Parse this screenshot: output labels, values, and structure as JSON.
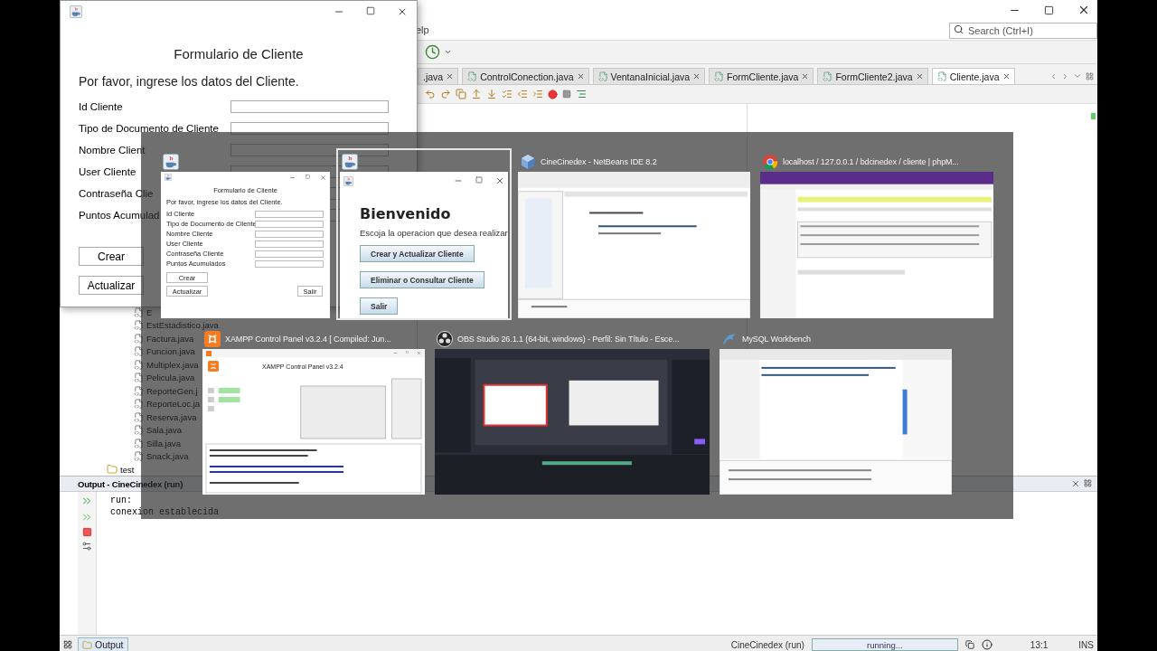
{
  "ide": {
    "menu_fragment": "elp",
    "search": {
      "placeholder": "Search (Ctrl+I)"
    },
    "editor_tabs": [
      {
        "label": ".java",
        "selected": false
      },
      {
        "label": "ControlConection.java",
        "selected": false
      },
      {
        "label": "VentanaInicial.java",
        "selected": false
      },
      {
        "label": "FormCliente.java",
        "selected": false
      },
      {
        "label": "FormCliente2.java",
        "selected": false
      },
      {
        "label": "Cliente.java",
        "selected": true
      }
    ],
    "project_tree": [
      {
        "label": "E",
        "kind": "file"
      },
      {
        "label": "EstEstadistico.java",
        "kind": "file"
      },
      {
        "label": "Factura.java",
        "kind": "file"
      },
      {
        "label": "Funcion.java",
        "kind": "file"
      },
      {
        "label": "Multiplex.java",
        "kind": "file"
      },
      {
        "label": "Pelicula.java",
        "kind": "file"
      },
      {
        "label": "ReporteGen.j",
        "kind": "file"
      },
      {
        "label": "ReporteLoc.ja",
        "kind": "file"
      },
      {
        "label": "Reserva.java",
        "kind": "file"
      },
      {
        "label": "Sala.java",
        "kind": "file"
      },
      {
        "label": "Silla.java",
        "kind": "file"
      },
      {
        "label": "Snack.java",
        "kind": "file"
      },
      {
        "label": "test",
        "kind": "folder"
      }
    ],
    "output": {
      "title": "Output - CineCinedex (run)",
      "lines": [
        "run:",
        "conexion establecida"
      ]
    },
    "status_bar": {
      "panel_tab": "Output",
      "task": "CineCinedex (run)",
      "progress": "running...",
      "position": "13:1",
      "mode": "INS"
    }
  },
  "form_window": {
    "heading": "Formulario de Cliente",
    "intro": "Por favor, ingrese los datos del Cliente.",
    "fields": [
      {
        "label": "Id Cliente"
      },
      {
        "label": "Tipo de Documento de Cliente"
      },
      {
        "label": "Nombre Client"
      },
      {
        "label": "User Cliente"
      },
      {
        "label": "Contraseña Clie"
      },
      {
        "label": "Puntos Acumulad"
      }
    ],
    "buttons": [
      "Crear",
      "Actualizar"
    ]
  },
  "task_switcher": {
    "windows": [
      {
        "kind": "java",
        "selected": false,
        "preview": {
          "kind": "form",
          "heading": "Formulario de Cliente",
          "intro": "Por favor, ingrese los datos del Cliente.",
          "labels": [
            "Id Cliente",
            "Tipo de Documento de Cliente",
            "Nombre Cliente",
            "User Cliente",
            "Contraseña Cliente",
            "Puntos Acumulados"
          ],
          "buttons": [
            "Crear",
            "Actualizar"
          ],
          "exit_button": "Salir"
        }
      },
      {
        "kind": "java",
        "selected": true,
        "preview": {
          "kind": "welcome",
          "heading": "Bienvenido",
          "prompt": "Escoja la operacion que desea realizar",
          "buttons": [
            "Crear y Actualizar Cliente",
            "Eliminar o Consultar Cliente",
            "Salir"
          ]
        }
      },
      {
        "kind": "netbeans",
        "title": "CineCinedex - NetBeans IDE 8.2",
        "selected": false,
        "preview": {
          "kind": "ide"
        }
      },
      {
        "kind": "chrome",
        "title": "localhost / 127.0.0.1 / bdcinedex / cliente | phpM...",
        "selected": false,
        "preview": {
          "kind": "browser"
        }
      },
      {
        "kind": "xampp",
        "title": "XAMPP Control Panel v3.2.4   [ Compiled: Jun...",
        "selected": false,
        "preview": {
          "kind": "xampp",
          "heading": "XAMPP Control Panel v3.2.4"
        }
      },
      {
        "kind": "obs",
        "title": "OBS Studio 26.1.1 (64-bit, windows) - Perfil: Sin Título - Esce...",
        "selected": false,
        "preview": {
          "kind": "streaming"
        }
      },
      {
        "kind": "mysql",
        "title": "MySQL Workbench",
        "selected": false,
        "preview": {
          "kind": "database"
        }
      }
    ]
  }
}
